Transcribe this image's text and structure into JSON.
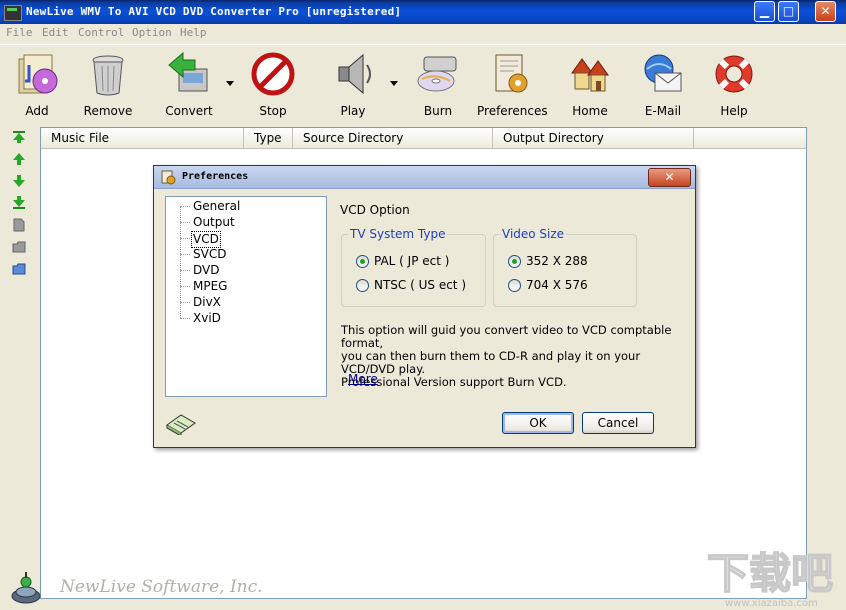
{
  "window": {
    "title": "NewLive WMV To AVI VCD DVD Converter Pro  [unregistered]"
  },
  "menu": [
    "File",
    "Edit",
    "Control",
    "Option",
    "Help"
  ],
  "toolbar": {
    "add": "Add",
    "remove": "Remove",
    "convert": "Convert",
    "stop": "Stop",
    "play": "Play",
    "burn": "Burn",
    "preferences": "Preferences",
    "home": "Home",
    "email": "E-Mail",
    "help": "Help"
  },
  "list": {
    "columns": [
      "Music File",
      "Type",
      "Source Directory",
      "Output Directory"
    ]
  },
  "footer": {
    "company": "NewLive Software, Inc."
  },
  "dialog": {
    "title": "Preferences",
    "tree": [
      "General",
      "Output",
      "VCD",
      "SVCD",
      "DVD",
      "MPEG",
      "DivX",
      "XviD"
    ],
    "selected": "VCD",
    "section_title": "VCD Option",
    "tv_system": {
      "title": "TV System Type",
      "options": [
        "PAL ( JP ect )",
        "NTSC ( US ect )"
      ],
      "selected": 0
    },
    "video_size": {
      "title": "Video Size",
      "options": [
        "352 X 288",
        "704 X 576"
      ],
      "selected": 0
    },
    "description_lines": [
      "This option will guid you convert video to VCD comptable format,",
      "you can then burn them to CD-R and play it on your VCD/DVD play.",
      "Professional  Version support Burn VCD."
    ],
    "more": "More",
    "ok": "OK",
    "cancel": "Cancel"
  },
  "watermark": {
    "text": "下载吧",
    "url": "www.xiazaiba.com"
  }
}
